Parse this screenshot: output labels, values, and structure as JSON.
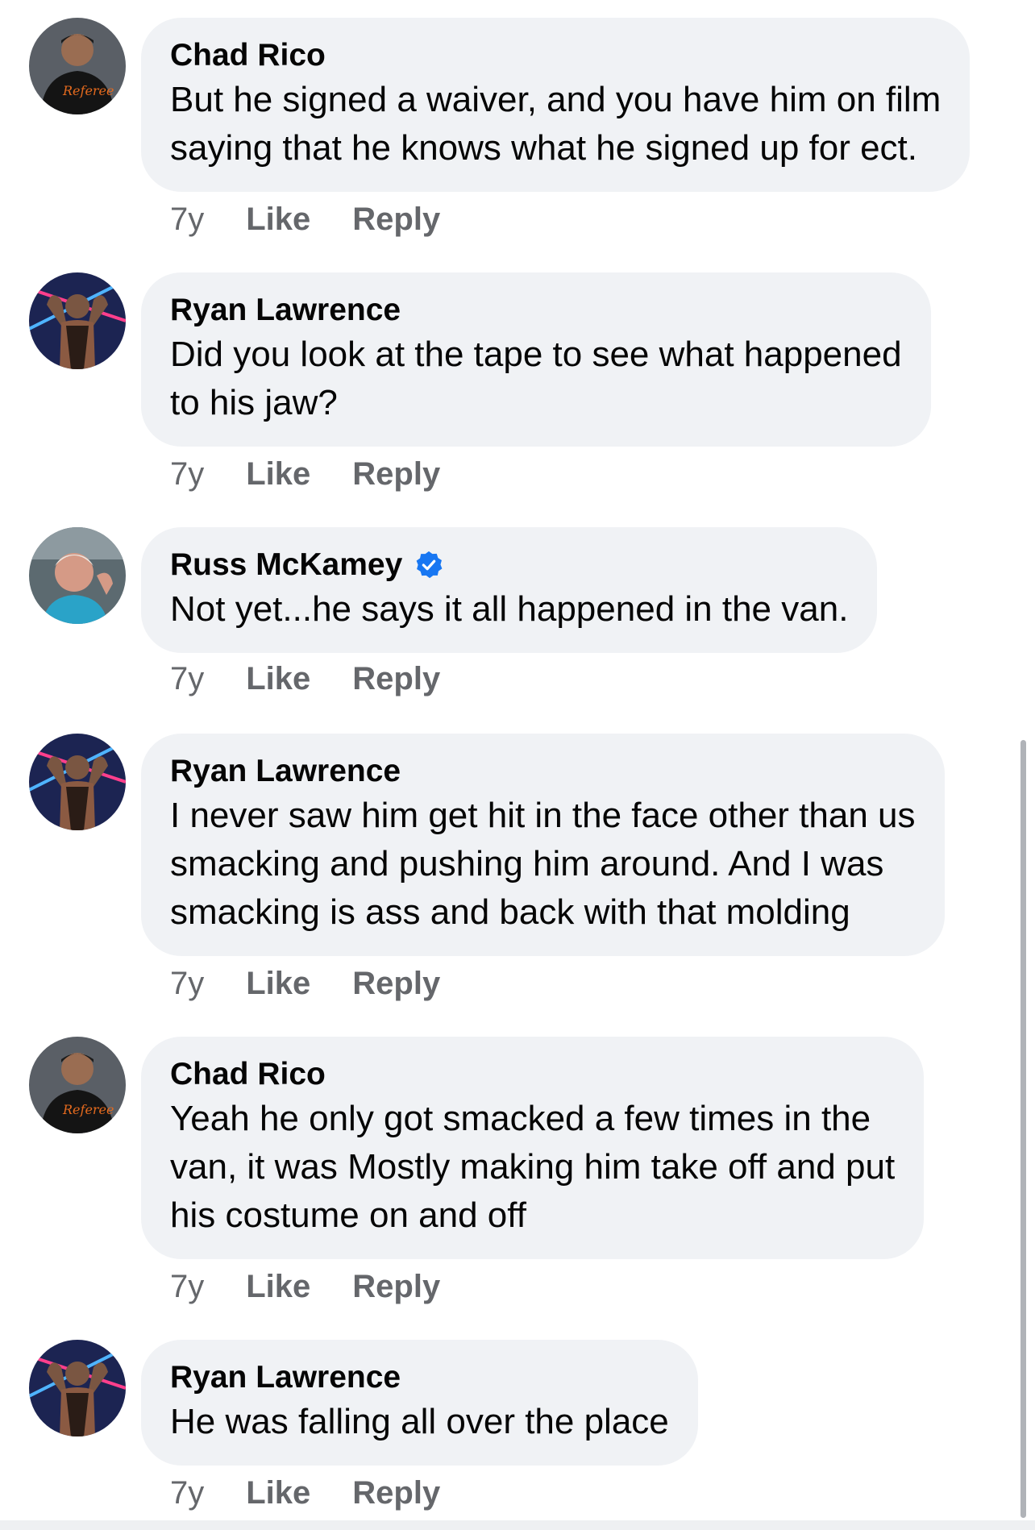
{
  "comments": [
    {
      "author": "Chad Rico",
      "verified": false,
      "avatar": "chad-rico-avatar",
      "lines": [
        "But he signed a waiver, and you have him on film",
        "saying that he knows what he signed up for ect."
      ],
      "time": "7y",
      "like": "Like",
      "reply": "Reply"
    },
    {
      "author": "Ryan Lawrence",
      "verified": false,
      "avatar": "ryan-lawrence-avatar",
      "lines": [
        "Did you look at the tape to see what happened",
        "to his jaw?"
      ],
      "time": "7y",
      "like": "Like",
      "reply": "Reply"
    },
    {
      "author": "Russ McKamey",
      "verified": true,
      "avatar": "russ-mckamey-avatar",
      "lines": [
        "Not yet...he says it all happened in the van."
      ],
      "time": "7y",
      "like": "Like",
      "reply": "Reply"
    },
    {
      "author": "Ryan Lawrence",
      "verified": false,
      "avatar": "ryan-lawrence-avatar",
      "lines": [
        "I never saw him get hit in the face other than us",
        "smacking and pushing him around. And I was",
        "smacking is ass and back with that molding"
      ],
      "time": "7y",
      "like": "Like",
      "reply": "Reply"
    },
    {
      "author": "Chad Rico",
      "verified": false,
      "avatar": "chad-rico-avatar",
      "lines": [
        "Yeah he only got smacked a few times in the",
        "van, it was Mostly making him take off and put",
        "his costume on and off"
      ],
      "time": "7y",
      "like": "Like",
      "reply": "Reply"
    },
    {
      "author": "Ryan Lawrence",
      "verified": false,
      "avatar": "ryan-lawrence-avatar",
      "lines": [
        "He was falling all over the place"
      ],
      "time": "7y",
      "like": "Like",
      "reply": "Reply"
    }
  ],
  "colors": {
    "bubble": "#f0f2f5",
    "meta_text": "#65676b",
    "verified_badge": "#1877f2"
  }
}
